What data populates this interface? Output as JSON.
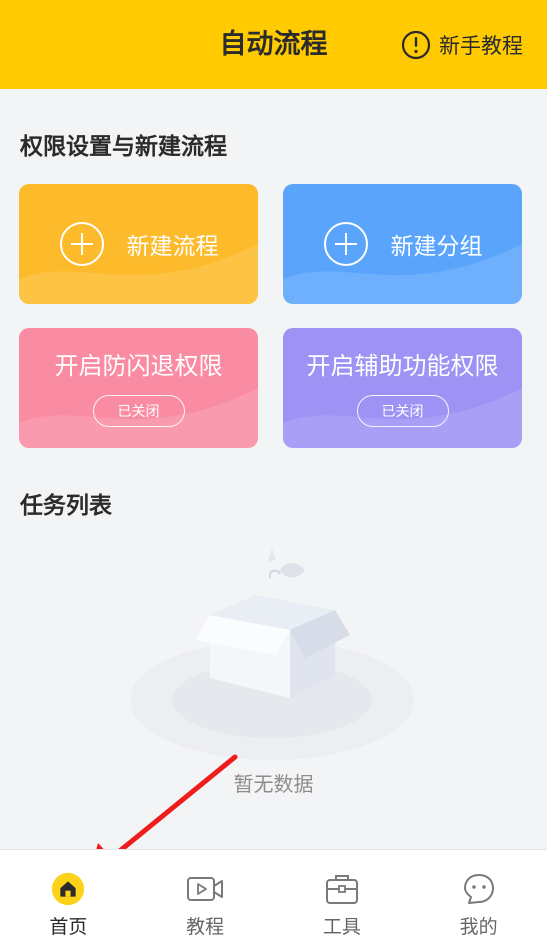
{
  "header": {
    "title": "自动流程",
    "tutorial_label": "新手教程",
    "tutorial_icon": "info-circle-icon",
    "background": "#ffcb00"
  },
  "permissions_section": {
    "title": "权限设置与新建流程",
    "cards": {
      "new_flow": {
        "label": "新建流程",
        "icon": "plus-circle-icon",
        "color": "#fdbb2c"
      },
      "new_group": {
        "label": "新建分组",
        "icon": "plus-circle-icon",
        "color": "#5aa5fb"
      },
      "anti_kill": {
        "label": "开启防闪退权限",
        "status": "已关闭",
        "color": "#f98ca3"
      },
      "accessibility": {
        "label": "开启辅助功能权限",
        "status": "已关闭",
        "color": "#9e92f5"
      }
    }
  },
  "task_section": {
    "title": "任务列表",
    "empty_text": "暂无数据",
    "empty_icon": "empty-box-icon"
  },
  "bottom_nav": {
    "items": [
      {
        "label": "首页",
        "icon": "home-icon",
        "active": true
      },
      {
        "label": "教程",
        "icon": "video-icon",
        "active": false
      },
      {
        "label": "工具",
        "icon": "toolbox-icon",
        "active": false
      },
      {
        "label": "我的",
        "icon": "profile-icon",
        "active": false
      }
    ]
  },
  "annotation": {
    "arrow_color": "#ef1c1c"
  }
}
